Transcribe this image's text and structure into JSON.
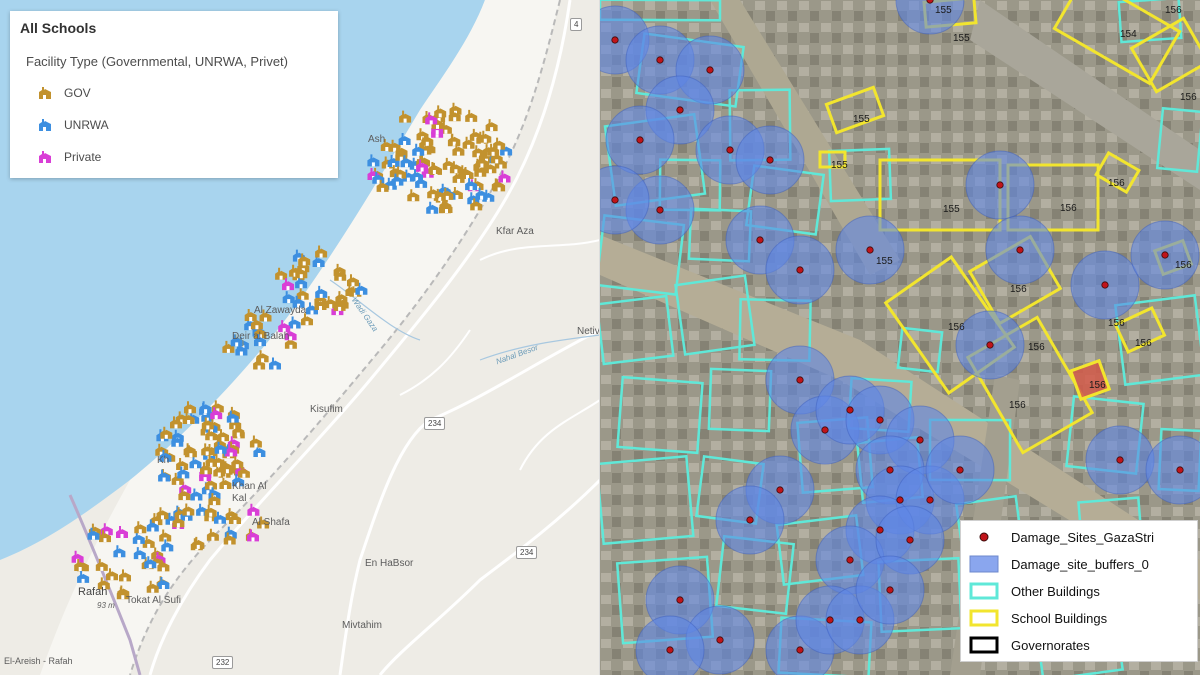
{
  "left_map": {
    "legend": {
      "title": "All Schools",
      "subtitle": "Facility Type (Governmental, UNRWA, Privet)",
      "items": [
        {
          "label": "GOV",
          "color": "#c2922e",
          "icon": "school-icon"
        },
        {
          "label": "UNRWA",
          "color": "#3d8fe0",
          "icon": "school-icon"
        },
        {
          "label": "Private",
          "color": "#d93ed6",
          "icon": "school-icon"
        }
      ]
    },
    "place_labels": [
      "Ash",
      "Kfar Aza",
      "Al Zawayda",
      "Deir al Balah",
      "Kisufim",
      "Kh",
      "Khan Al",
      "Kal",
      "Rafah",
      "Tokat Al Sufi",
      "En HaBsor",
      "Mivtahim",
      "El-Areish - Rafah",
      "Netiv",
      "Al Shafa"
    ],
    "water_labels": [
      "Wadi Gaza",
      "Nahal Besor"
    ],
    "elevation_label": "93 m",
    "road_shields": [
      "4",
      "234",
      "234",
      "232"
    ],
    "colors": {
      "sea": "#a8d4ee",
      "land": "#eeece6",
      "strip": "#f6f5f1",
      "road": "#ffffff"
    }
  },
  "right_map": {
    "building_labels": [
      "155",
      "155",
      "155",
      "155",
      "154",
      "155",
      "155",
      "156",
      "156",
      "156",
      "156",
      "156",
      "156",
      "156",
      "156",
      "156",
      "156",
      "156",
      "156"
    ],
    "legend": {
      "items": [
        {
          "label": "Damage_Sites_GazaStri",
          "symbol": "red-dot"
        },
        {
          "label": "Damage_site_buffers_0",
          "symbol": "blue-fill"
        },
        {
          "label": "Other Buildings",
          "symbol": "cyan-outline"
        },
        {
          "label": "School Buildings",
          "symbol": "yellow-outline"
        },
        {
          "label": "Governorates",
          "symbol": "black-outline"
        }
      ]
    },
    "colors": {
      "damage_site": "#c0141a",
      "buffer": "#5f87e6",
      "other_buildings": "#5fe8d8",
      "school_buildings": "#f2e52e",
      "governorates": "#000000"
    }
  }
}
